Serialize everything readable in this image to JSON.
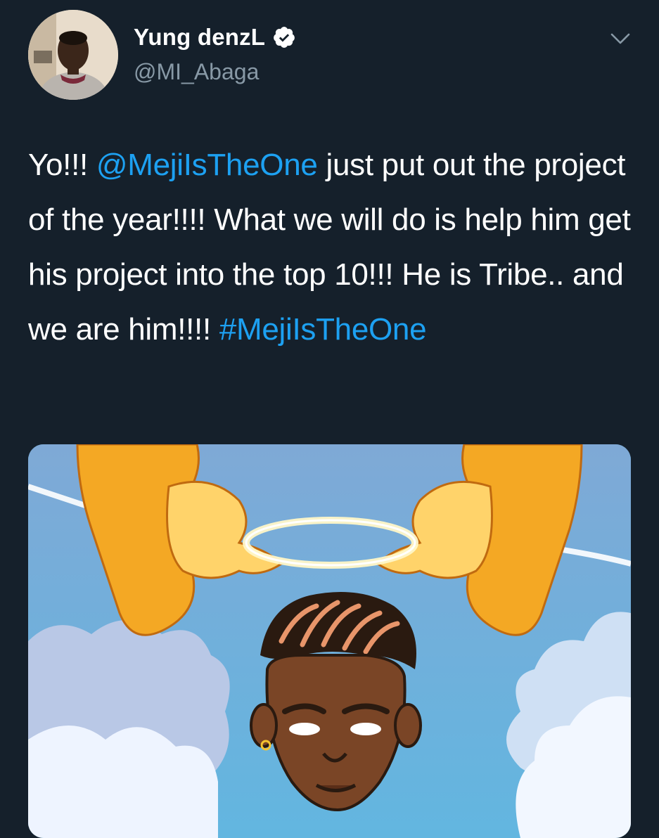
{
  "tweet": {
    "author": {
      "display_name": "Yung denzL",
      "handle": "@MI_Abaga",
      "verified": true,
      "avatar_icon": "profile-photo"
    },
    "menu_icon": "chevron-down-icon",
    "text_parts": [
      {
        "type": "text",
        "value": "Yo!!! "
      },
      {
        "type": "mention",
        "value": "@MejiIsTheOne"
      },
      {
        "type": "text",
        "value": " just put out the project of the year!!!! What we will do is help him get his project into the top 10!!! He is Tribe.. and we are him!!!! "
      },
      {
        "type": "hashtag",
        "value": "#MejiIsTheOne"
      }
    ],
    "media": {
      "kind": "illustration",
      "description_icon": "album-art-illustration"
    }
  },
  "colors": {
    "background": "#15202b",
    "text": "#ffffff",
    "secondary_text": "#8899a6",
    "link": "#1da1f2"
  }
}
